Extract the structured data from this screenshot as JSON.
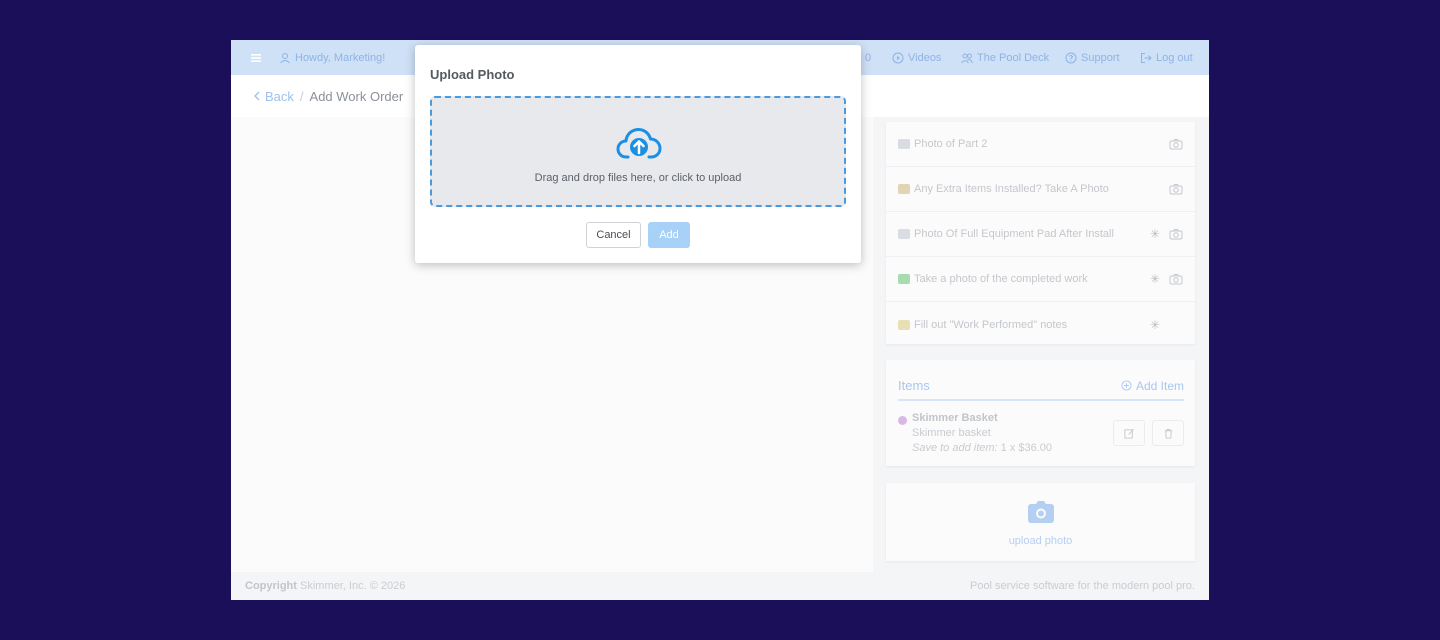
{
  "topbar": {
    "menu_icon": "hamburger-icon",
    "user_greeting": "Howdy, Marketing!",
    "partial_link": "0",
    "nav": [
      {
        "label": "Videos",
        "icon": "play-circle-icon"
      },
      {
        "label": "The Pool Deck",
        "icon": "users-icon"
      },
      {
        "label": "Support",
        "icon": "question-circle-icon"
      },
      {
        "label": "Log out",
        "icon": "logout-icon"
      }
    ]
  },
  "breadcrumb": {
    "back_label": "Back",
    "separator": "/",
    "current": "Add Work Order"
  },
  "checklist": [
    {
      "label": "Photo of Part 2",
      "emoji_color": "#d9dce2",
      "required": false,
      "camera": true
    },
    {
      "label": "Any Extra Items Installed? Take A Photo",
      "emoji_color": "#e3d4b3",
      "required": false,
      "camera": true
    },
    {
      "label": "Photo Of Full Equipment Pad After Install",
      "emoji_color": "#d9dce2",
      "required": true,
      "camera": true
    },
    {
      "label": "Take a photo of the completed work",
      "emoji_color": "#a8dcae",
      "required": true,
      "camera": true
    },
    {
      "label": "Fill out \"Work Performed\" notes",
      "emoji_color": "#e8e0b5",
      "required": true,
      "camera": false
    }
  ],
  "required_marker": "✳",
  "items": {
    "title": "Items",
    "add_label": "Add Item",
    "entries": [
      {
        "name": "Skimmer Basket",
        "description": "Skimmer basket",
        "price_prefix": "Save to add item:",
        "price": "1 x $36.00"
      }
    ]
  },
  "photo_upload": {
    "label": "upload photo"
  },
  "footer": {
    "copyright_bold": "Copyright",
    "copyright_text": "Skimmer, Inc. © 2026",
    "tagline": "Pool service software for the modern pool pro."
  },
  "modal": {
    "title": "Upload Photo",
    "dropzone_text": "Drag and drop files here, or click to upload",
    "cancel_label": "Cancel",
    "add_label": "Add"
  },
  "colors": {
    "background": "#1b0f5a",
    "accent": "#4a9ae0",
    "add_button": "#a8d1f7"
  }
}
